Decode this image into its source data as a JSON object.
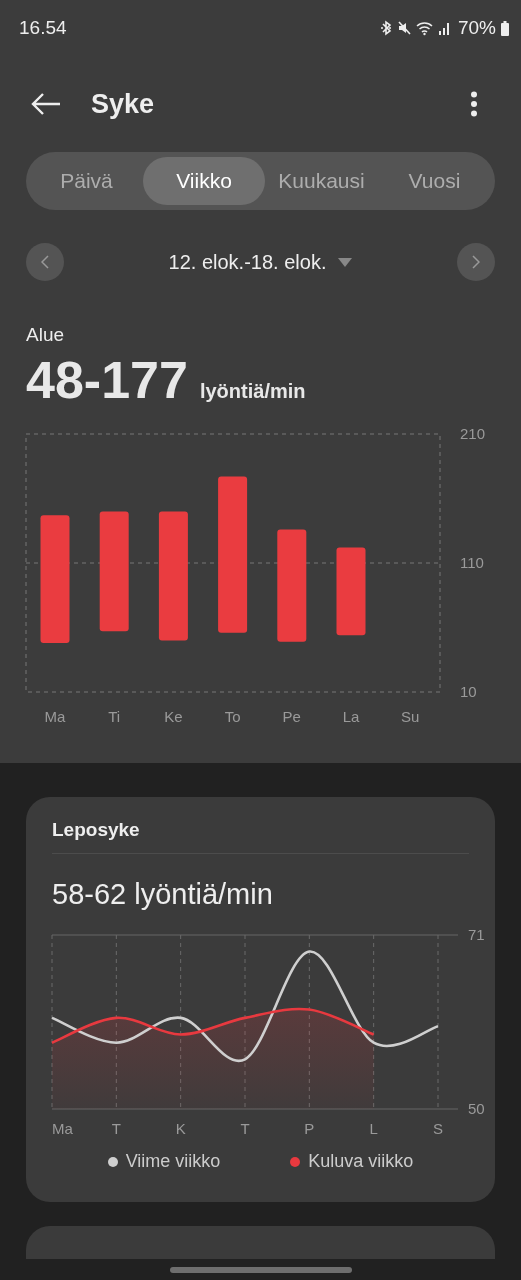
{
  "status_bar": {
    "time": "16.54",
    "battery": "70%"
  },
  "header": {
    "title": "Syke"
  },
  "tabs": [
    {
      "label": "Päivä",
      "selected": false
    },
    {
      "label": "Viikko",
      "selected": true
    },
    {
      "label": "Kuukausi",
      "selected": false
    },
    {
      "label": "Vuosi",
      "selected": false
    }
  ],
  "date_range": {
    "label": "12. elok.-18. elok."
  },
  "summary": {
    "label": "Alue",
    "value": "48-177",
    "unit": "lyöntiä/min"
  },
  "range_chart": {
    "chart_data": {
      "type": "candlestick",
      "categories": [
        "Ma",
        "Ti",
        "Ke",
        "To",
        "Pe",
        "La",
        "Su"
      ],
      "ylim": [
        10,
        210
      ],
      "yticks": [
        10,
        110,
        210
      ],
      "grid": true,
      "series": [
        {
          "color": "#ea3c40",
          "ohlc": [
            [
              48,
              147,
              48,
              147
            ],
            [
              57,
              150,
              57,
              150
            ],
            [
              50,
              150,
              50,
              150
            ],
            [
              56,
              177,
              56,
              177
            ],
            [
              49,
              136,
              49,
              136
            ],
            [
              54,
              122,
              54,
              122
            ],
            null
          ]
        }
      ]
    }
  },
  "resting_card": {
    "title": "Leposyke",
    "value": "58-62 lyöntiä/min",
    "chart_data": {
      "type": "line",
      "categories": [
        "Ma",
        "T",
        "K",
        "T",
        "P",
        "L",
        "S"
      ],
      "ylim": [
        50,
        71
      ],
      "yticks": [
        50,
        71
      ],
      "grid": true,
      "series": [
        {
          "name": "Viime viikko",
          "color": "#cfcfcf",
          "values": [
            61,
            58,
            61,
            56,
            69,
            58,
            60
          ]
        },
        {
          "name": "Kuluva viikko",
          "color": "#e8393f",
          "values": [
            58,
            61,
            59,
            61,
            62,
            59,
            null
          ]
        }
      ]
    }
  }
}
